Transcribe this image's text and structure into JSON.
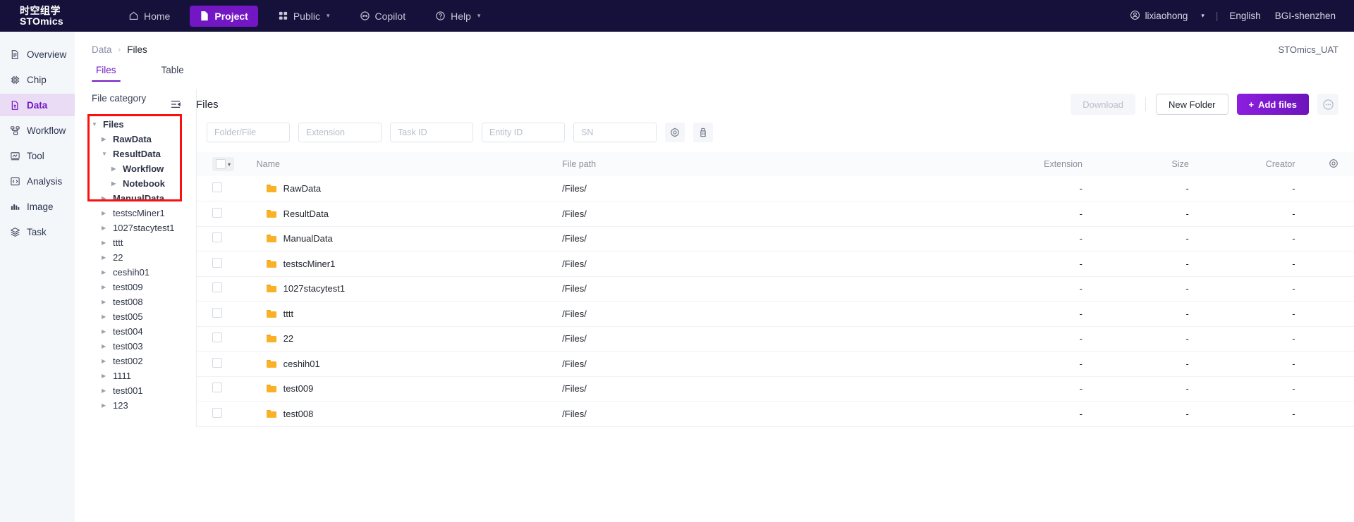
{
  "topbar": {
    "brand_cn": "时空组学",
    "brand_en": "STOmics",
    "nav": [
      {
        "label": "Home",
        "icon": "home-icon",
        "active": false,
        "caret": false
      },
      {
        "label": "Project",
        "icon": "file-icon",
        "active": true,
        "caret": false
      },
      {
        "label": "Public",
        "icon": "grid-icon",
        "active": false,
        "caret": true
      },
      {
        "label": "Copilot",
        "icon": "copilot-icon",
        "active": false,
        "caret": false
      },
      {
        "label": "Help",
        "icon": "help-icon",
        "active": false,
        "caret": true
      }
    ],
    "user": "lixiaohong",
    "divider": "|",
    "language": "English",
    "org": "BGI-shenzhen"
  },
  "rail": {
    "items": [
      {
        "label": "Overview",
        "icon": "document-icon",
        "active": false
      },
      {
        "label": "Chip",
        "icon": "chip-icon",
        "active": false
      },
      {
        "label": "Data",
        "icon": "data-upload-icon",
        "active": true
      },
      {
        "label": "Workflow",
        "icon": "workflow-icon",
        "active": false
      },
      {
        "label": "Tool",
        "icon": "tool-icon",
        "active": false
      },
      {
        "label": "Analysis",
        "icon": "code-icon",
        "active": false
      },
      {
        "label": "Image",
        "icon": "image-icon",
        "active": false
      },
      {
        "label": "Task",
        "icon": "task-icon",
        "active": false
      }
    ]
  },
  "breadcrumb": {
    "root": "Data",
    "sep": "›",
    "current": "Files"
  },
  "env_tag": "STOmics_UAT",
  "tabs": [
    {
      "label": "Files",
      "active": true
    },
    {
      "label": "Table",
      "active": false
    }
  ],
  "category": {
    "title": "File category",
    "collapse_icon": "collapse-panel-icon",
    "tree": [
      {
        "label": "Files",
        "depth": 0,
        "expanded": true,
        "bold": true
      },
      {
        "label": "RawData",
        "depth": 1,
        "expanded": false,
        "bold": true
      },
      {
        "label": "ResultData",
        "depth": 1,
        "expanded": true,
        "bold": true
      },
      {
        "label": "Workflow",
        "depth": 2,
        "expanded": false,
        "bold": true
      },
      {
        "label": "Notebook",
        "depth": 2,
        "expanded": false,
        "bold": true
      },
      {
        "label": "ManualData",
        "depth": 1,
        "expanded": false,
        "bold": true
      },
      {
        "label": "testscMiner1",
        "depth": 1,
        "expanded": false,
        "bold": false
      },
      {
        "label": "1027stacytest1",
        "depth": 1,
        "expanded": false,
        "bold": false
      },
      {
        "label": "tttt",
        "depth": 1,
        "expanded": false,
        "bold": false
      },
      {
        "label": "22",
        "depth": 1,
        "expanded": false,
        "bold": false
      },
      {
        "label": "ceshih01",
        "depth": 1,
        "expanded": false,
        "bold": false
      },
      {
        "label": "test009",
        "depth": 1,
        "expanded": false,
        "bold": false
      },
      {
        "label": "test008",
        "depth": 1,
        "expanded": false,
        "bold": false
      },
      {
        "label": "test005",
        "depth": 1,
        "expanded": false,
        "bold": false
      },
      {
        "label": "test004",
        "depth": 1,
        "expanded": false,
        "bold": false
      },
      {
        "label": "test003",
        "depth": 1,
        "expanded": false,
        "bold": false
      },
      {
        "label": "test002",
        "depth": 1,
        "expanded": false,
        "bold": false
      },
      {
        "label": "1111",
        "depth": 1,
        "expanded": false,
        "bold": false
      },
      {
        "label": "test001",
        "depth": 1,
        "expanded": false,
        "bold": false
      },
      {
        "label": "123",
        "depth": 1,
        "expanded": false,
        "bold": false
      }
    ],
    "highlight_color": "#fb0f0f"
  },
  "files": {
    "title": "Files",
    "collapse_icon": "collapse-tree-icon",
    "actions": {
      "download": "Download",
      "new_folder": "New Folder",
      "add_files": "Add files",
      "add_files_plus": "+",
      "more_icon": "ellipsis-icon"
    },
    "filters": [
      {
        "name": "folder-file",
        "placeholder": "Folder/File",
        "value": ""
      },
      {
        "name": "extension",
        "placeholder": "Extension",
        "value": ""
      },
      {
        "name": "task-id",
        "placeholder": "Task ID",
        "value": ""
      },
      {
        "name": "entity-id",
        "placeholder": "Entity ID",
        "value": ""
      },
      {
        "name": "sn",
        "placeholder": "SN",
        "value": ""
      }
    ],
    "filter_buttons": [
      {
        "name": "search-settings-icon"
      },
      {
        "name": "clear-filters-icon"
      }
    ],
    "table": {
      "columns": [
        "Name",
        "File path",
        "Extension",
        "Size",
        "Creator"
      ],
      "settings_icon": "column-settings-icon",
      "rows": [
        {
          "name": "RawData",
          "path": "/Files/",
          "extension": "-",
          "size": "-",
          "creator": "-",
          "icon": "folder-icon"
        },
        {
          "name": "ResultData",
          "path": "/Files/",
          "extension": "-",
          "size": "-",
          "creator": "-",
          "icon": "folder-icon"
        },
        {
          "name": "ManualData",
          "path": "/Files/",
          "extension": "-",
          "size": "-",
          "creator": "-",
          "icon": "folder-icon"
        },
        {
          "name": "testscMiner1",
          "path": "/Files/",
          "extension": "-",
          "size": "-",
          "creator": "-",
          "icon": "folder-icon"
        },
        {
          "name": "1027stacytest1",
          "path": "/Files/",
          "extension": "-",
          "size": "-",
          "creator": "-",
          "icon": "folder-icon"
        },
        {
          "name": "tttt",
          "path": "/Files/",
          "extension": "-",
          "size": "-",
          "creator": "-",
          "icon": "folder-icon"
        },
        {
          "name": "22",
          "path": "/Files/",
          "extension": "-",
          "size": "-",
          "creator": "-",
          "icon": "folder-icon"
        },
        {
          "name": "ceshih01",
          "path": "/Files/",
          "extension": "-",
          "size": "-",
          "creator": "-",
          "icon": "folder-icon"
        },
        {
          "name": "test009",
          "path": "/Files/",
          "extension": "-",
          "size": "-",
          "creator": "-",
          "icon": "folder-icon"
        },
        {
          "name": "test008",
          "path": "/Files/",
          "extension": "-",
          "size": "-",
          "creator": "-",
          "icon": "folder-icon"
        }
      ]
    }
  },
  "colors": {
    "topbar_bg": "#16113a",
    "accent": "#7317c4",
    "rail_bg": "#f4f7fa",
    "folder": "#f9b227",
    "highlight": "#fb0f0f"
  }
}
